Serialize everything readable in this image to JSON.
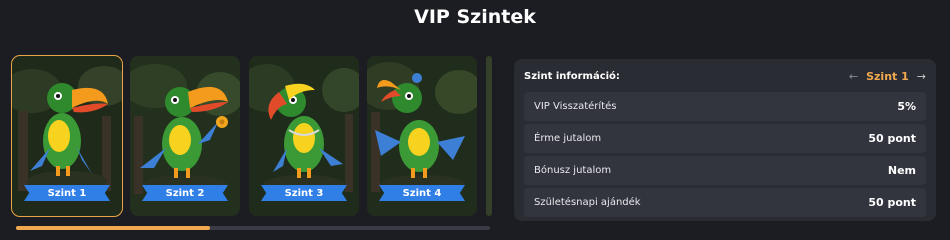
{
  "page": {
    "title": "VIP Szintek"
  },
  "levels": [
    {
      "label": "Szint 1",
      "active": true
    },
    {
      "label": "Szint 2",
      "active": false
    },
    {
      "label": "Szint 3",
      "active": false
    },
    {
      "label": "Szint 4",
      "active": false
    }
  ],
  "carousel": {
    "scroll_progress": 0.41
  },
  "info": {
    "title": "Szint információ:",
    "current_level": "Szint 1",
    "prev_icon": "arrow-left-icon",
    "next_icon": "arrow-right-icon",
    "rows": [
      {
        "label": "VIP Visszatérítés",
        "value": "5%"
      },
      {
        "label": "Érme jutalom",
        "value": "50 pont"
      },
      {
        "label": "Bónusz jutalom",
        "value": "Nem"
      },
      {
        "label": "Születésnapi ajándék",
        "value": "50 pont"
      }
    ]
  },
  "colors": {
    "accent": "#f0a94e",
    "ribbon": "#2f7fe6",
    "background": "#1c1d23",
    "panel": "#2a2c34"
  }
}
